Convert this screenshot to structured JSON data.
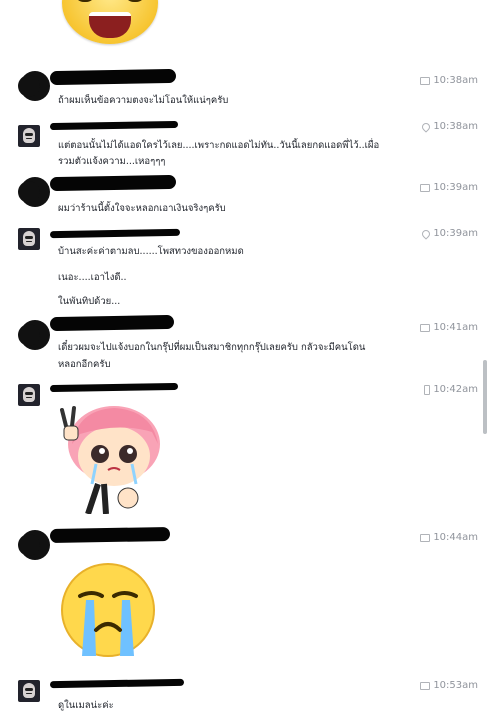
{
  "messages": [
    {
      "id": "m1",
      "avatar": "black",
      "time": "10:38am",
      "icon": "message-icon",
      "lines": [
        "ถ้าผมเห็นข้อความตงจะไม่โอนให้แน่ๆครับ"
      ]
    },
    {
      "id": "m2",
      "avatar": "ghost",
      "time": "10:38am",
      "icon": "pin-icon",
      "lines": [
        "แต่ตอนนั้นไม่ได้แอดใครไว้เลย....เพราะกดแอดไม่ทัน..วันนี้เลยกดแอดพี่ไว้..เผื่อ",
        "รวมตัวแจ้งความ...เหอๆๆๆ"
      ]
    },
    {
      "id": "m3",
      "avatar": "black",
      "time": "10:39am",
      "icon": "message-icon",
      "lines": [
        "ผมว่าร้านนี้ตั้งใจจะหลอกเอาเงินจริงๆครับ"
      ]
    },
    {
      "id": "m4",
      "avatar": "ghost",
      "time": "10:39am",
      "icon": "pin-icon",
      "lines": [
        "บ้านสะค่ะค่าตามลบ......โพสทวงของออกหมด",
        "เนอะ....เอาไงดี..",
        "ในพันทิปด้วย..."
      ]
    },
    {
      "id": "m5",
      "avatar": "black",
      "time": "10:41am",
      "icon": "message-icon",
      "lines": [
        "เดี๋ยวผมจะไปแจ้งบอกในกรุ๊ปที่ผมเป็นสมาชิกทุกกรุ๊ปเลยครับ กลัวจะมีคนโดน",
        "หลอกอีกครับ"
      ]
    },
    {
      "id": "m6",
      "avatar": "ghost",
      "time": "10:42am",
      "icon": "phone-icon",
      "lines": []
    },
    {
      "id": "m7",
      "avatar": "black",
      "time": "10:44am",
      "icon": "message-icon",
      "lines": []
    },
    {
      "id": "m8",
      "avatar": "ghost",
      "time": "10:53am",
      "icon": "message-icon",
      "lines": [
        "ดูในเมลน่ะค่ะ"
      ]
    }
  ]
}
